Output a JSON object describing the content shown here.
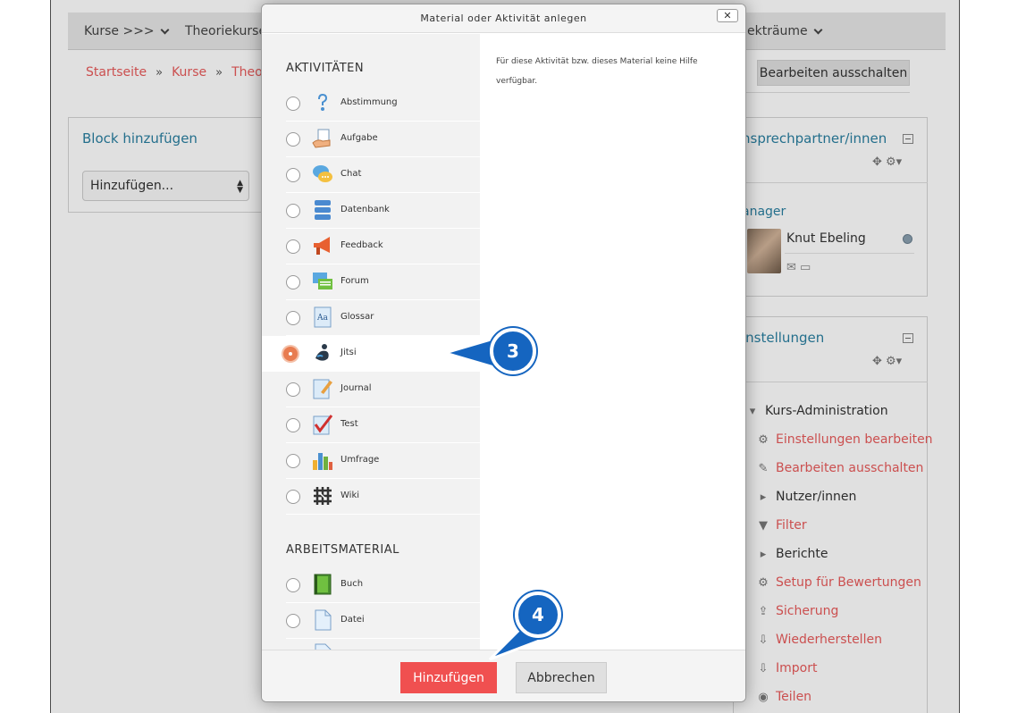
{
  "navbar": {
    "items": [
      {
        "label": "Kurse >>>"
      },
      {
        "label": "Theoriekurse"
      },
      {
        "label": "ekträume"
      }
    ]
  },
  "breadcrumb": [
    "Startseite",
    "Kurse",
    "Theorie"
  ],
  "edit_button": "Bearbeiten ausschalten",
  "block_add": {
    "title": "Block hinzufügen",
    "select_value": "Hinzufügen..."
  },
  "contacts_block": {
    "title": "nsprechpartner/innen",
    "role": "anager",
    "person_name": "Knut Ebeling"
  },
  "settings_block": {
    "title": "instellungen",
    "root": "Kurs-Administration",
    "items": [
      {
        "label": "Einstellungen bearbeiten",
        "icon": "gear-icon"
      },
      {
        "label": "Bearbeiten ausschalten",
        "icon": "pencil-icon"
      },
      {
        "label": "Nutzer/innen",
        "icon": "caret-right-icon"
      },
      {
        "label": "Filter",
        "icon": "filter-icon"
      },
      {
        "label": "Berichte",
        "icon": "caret-right-icon"
      },
      {
        "label": "Setup für Bewertungen",
        "icon": "gear-icon"
      },
      {
        "label": "Sicherung",
        "icon": "upload-icon"
      },
      {
        "label": "Wiederherstellen",
        "icon": "download-icon"
      },
      {
        "label": "Import",
        "icon": "download-icon"
      },
      {
        "label": "Teilen",
        "icon": "share-icon"
      }
    ]
  },
  "dialog": {
    "title": "Material oder Aktivität anlegen",
    "close": "✕",
    "help_text": "Für diese Aktivität bzw. dieses Material keine Hilfe verfügbar.",
    "categories": {
      "activities": "AKTIVITÄTEN",
      "resources": "ARBEITSMATERIAL"
    },
    "activities": [
      {
        "label": "Abstimmung",
        "icon": "question-icon"
      },
      {
        "label": "Aufgabe",
        "icon": "assignment-icon"
      },
      {
        "label": "Chat",
        "icon": "chat-icon"
      },
      {
        "label": "Datenbank",
        "icon": "database-icon"
      },
      {
        "label": "Feedback",
        "icon": "megaphone-icon"
      },
      {
        "label": "Forum",
        "icon": "forum-icon"
      },
      {
        "label": "Glossar",
        "icon": "glossary-icon"
      },
      {
        "label": "Jitsi",
        "icon": "jitsi-icon",
        "selected": true
      },
      {
        "label": "Journal",
        "icon": "journal-icon"
      },
      {
        "label": "Test",
        "icon": "quiz-icon"
      },
      {
        "label": "Umfrage",
        "icon": "survey-icon"
      },
      {
        "label": "Wiki",
        "icon": "wiki-icon"
      }
    ],
    "resources": [
      {
        "label": "Buch",
        "icon": "book-icon"
      },
      {
        "label": "Datei",
        "icon": "file-icon"
      }
    ],
    "add_button": "Hinzufügen",
    "cancel_button": "Abbrechen"
  },
  "callouts": [
    "3",
    "4"
  ],
  "colors": {
    "accent_red": "#e85b5b",
    "link_blue": "#2a7fa0",
    "callout_blue": "#1565c0",
    "radio_selected": "#e87c50"
  }
}
